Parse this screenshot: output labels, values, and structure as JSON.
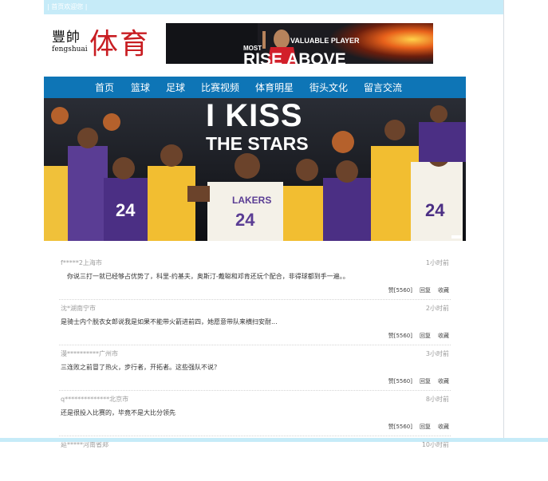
{
  "topbar": {
    "text": "| 首页欢迎您 |"
  },
  "logo": {
    "chinese": "豐帥",
    "english": "fengshuai",
    "title": "体育"
  },
  "ad": {
    "line1": "MOST",
    "line2": "VALUABLE PLAYER",
    "line3": "RISE ABOVE"
  },
  "nav": [
    "首页",
    "篮球",
    "足球",
    "比赛视频",
    "体育明星",
    "街头文化",
    "留言交流"
  ],
  "hero": {
    "line1": "I KISS",
    "line2": "THE STARS",
    "jersey": "24",
    "team": "LAKERS"
  },
  "comments": [
    {
      "user": "f*****2上海市",
      "time": "1小时前",
      "text": "你说三打一就已经够占优势了，科里-约基夫，奥斯汀-戴聪和邓肯还玩个配合，非得球都到手一遍。。",
      "actions": [
        "赞[5560]",
        "回复",
        "收藏"
      ]
    },
    {
      "user": "沈*湖南宁市",
      "time": "2小时前",
      "text": "是骑士内个脱衣女郎说我是如果不能带火箭进前四，她愿意带队来横扫安耐...",
      "actions": [
        "赞[5560]",
        "回复",
        "收藏"
      ]
    },
    {
      "user": "漫**********广州市",
      "time": "3小时前",
      "text": "三连败之前冒了热火，步行者，开拓者。这些强队不说？",
      "actions": [
        "赞[5560]",
        "回复",
        "收藏"
      ]
    },
    {
      "user": "q**************北京市",
      "time": "8小时前",
      "text": "还是很投入比赛的，毕竟不是大比分领先",
      "actions": [
        "赞[5560]",
        "回复",
        "收藏"
      ]
    },
    {
      "user": "延*****河南省郑",
      "time": "10小时前",
      "text": "",
      "actions": []
    }
  ]
}
